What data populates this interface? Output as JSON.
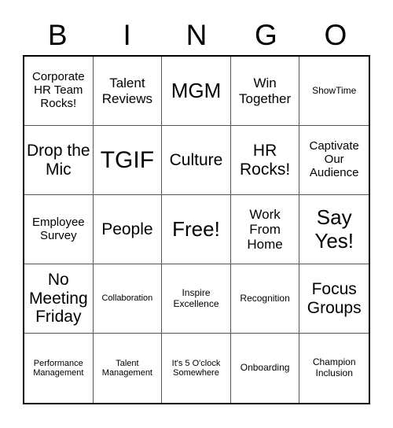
{
  "header": {
    "letters": [
      "B",
      "I",
      "N",
      "G",
      "O"
    ]
  },
  "grid": {
    "rows": 5,
    "columns": 5,
    "free_space_index": 12,
    "cells": [
      {
        "text": "Corporate HR Team Rocks!",
        "size": "sz-xs"
      },
      {
        "text": "Talent Reviews",
        "size": "sz-sm"
      },
      {
        "text": "MGM",
        "size": "sz-lg"
      },
      {
        "text": "Win Together",
        "size": "sz-sm"
      },
      {
        "text": "ShowTime",
        "size": "sz-xxs"
      },
      {
        "text": "Drop the Mic",
        "size": "sz-md"
      },
      {
        "text": "TGIF",
        "size": "sz-xl"
      },
      {
        "text": "Culture",
        "size": "sz-md"
      },
      {
        "text": "HR Rocks!",
        "size": "sz-md"
      },
      {
        "text": "Captivate Our Audience",
        "size": "sz-xs"
      },
      {
        "text": "Employee Survey",
        "size": "sz-xs"
      },
      {
        "text": "People",
        "size": "sz-md"
      },
      {
        "text": "Free!",
        "size": "sz-lg"
      },
      {
        "text": "Work From Home",
        "size": "sz-sm"
      },
      {
        "text": "Say Yes!",
        "size": "sz-lg"
      },
      {
        "text": "No Meeting Friday",
        "size": "sz-md"
      },
      {
        "text": "Collaboration",
        "size": "sz-tiny"
      },
      {
        "text": "Inspire Excellence",
        "size": "sz-xxs"
      },
      {
        "text": "Recognition",
        "size": "sz-xxs"
      },
      {
        "text": "Focus Groups",
        "size": "sz-md"
      },
      {
        "text": "Performance Management",
        "size": "sz-tiny"
      },
      {
        "text": "Talent Management",
        "size": "sz-tiny"
      },
      {
        "text": "It's 5 O'clock Somewhere",
        "size": "sz-tiny"
      },
      {
        "text": "Onboarding",
        "size": "sz-xxs"
      },
      {
        "text": "Champion Inclusion",
        "size": "sz-xxs"
      }
    ]
  },
  "colors": {
    "background": "#ffffff",
    "text": "#000000",
    "outer_border": "#000000",
    "inner_border": "#555555"
  }
}
